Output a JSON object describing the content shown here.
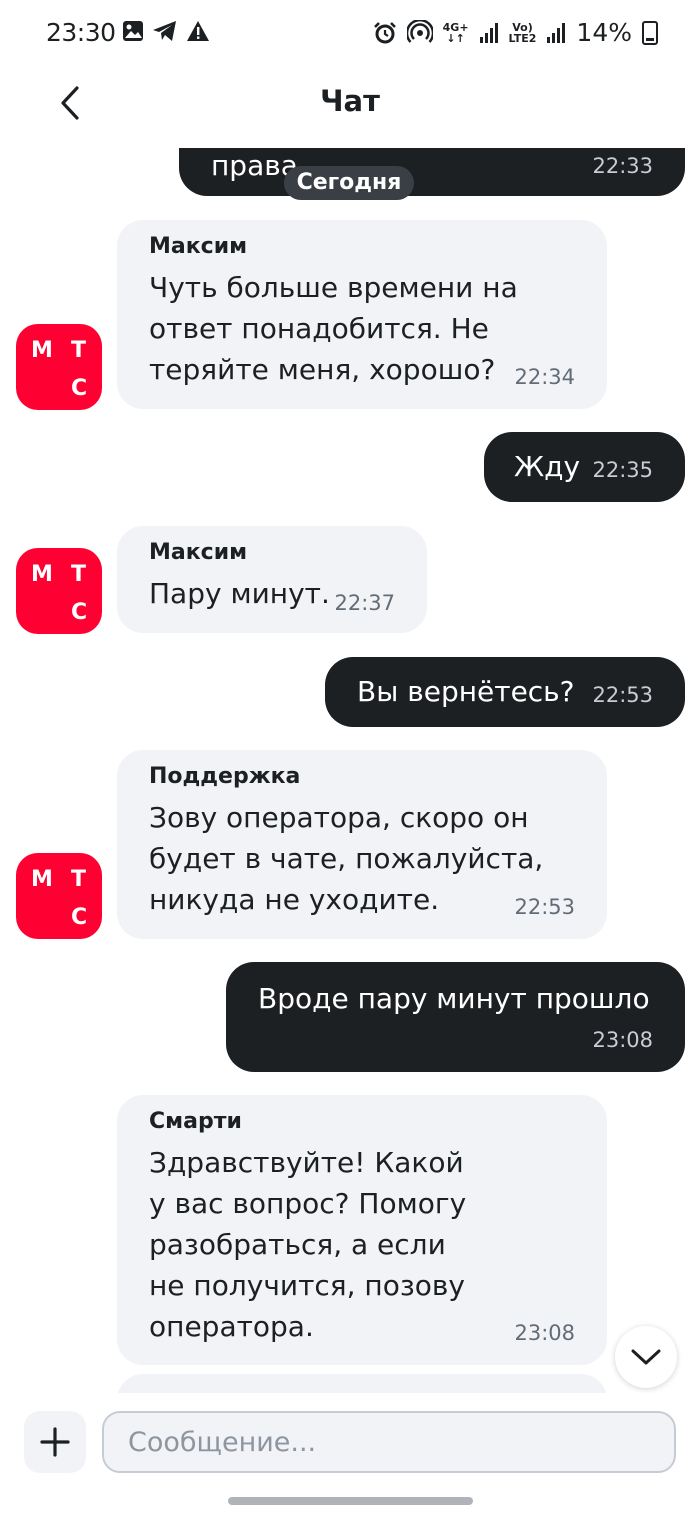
{
  "status_bar": {
    "time": "23:30",
    "network_top": "4G+",
    "volte_top": "Vo)",
    "volte_bottom": "LTE2",
    "battery": "14%"
  },
  "header": {
    "title": "Чат"
  },
  "chat": {
    "date_separator": "Сегодня",
    "messages": [
      {
        "direction": "out",
        "text": "права",
        "time": "22:33"
      },
      {
        "direction": "in",
        "sender": "Максим",
        "text": "Чуть больше времени на ответ понадобится. Не теряйте меня, хорошо?",
        "time": "22:34"
      },
      {
        "direction": "out",
        "text": "Жду",
        "time": "22:35"
      },
      {
        "direction": "in",
        "sender": "Максим",
        "text": "Пару минут.",
        "time": "22:37"
      },
      {
        "direction": "out",
        "text": "Вы вернётесь?",
        "time": "22:53"
      },
      {
        "direction": "in",
        "sender": "Поддержка",
        "text": "Зову оператора, скоро он будет в чате, пожалуйста, никуда не уходите.",
        "time": "22:53"
      },
      {
        "direction": "out",
        "text": "Вроде пару минут прошло",
        "time": "23:08"
      },
      {
        "direction": "in",
        "sender": "Смарти",
        "text": "Здравствуйте! Какой у вас вопрос? Помогу разобраться, а если не получится, позову оператора.",
        "time": "23:08"
      }
    ],
    "avatar_letters": [
      "М",
      "Т",
      "С"
    ]
  },
  "composer": {
    "placeholder": "Сообщение..."
  },
  "colors": {
    "brand": "#ff0032",
    "outgoing_bubble": "#1d2023",
    "incoming_bubble": "#f2f3f7"
  },
  "icons": [
    "image-icon",
    "telegram-icon",
    "warning-icon",
    "alarm-icon",
    "hotspot-icon",
    "signal-icon",
    "battery-icon",
    "back-icon",
    "chevron-down-icon",
    "plus-icon"
  ]
}
